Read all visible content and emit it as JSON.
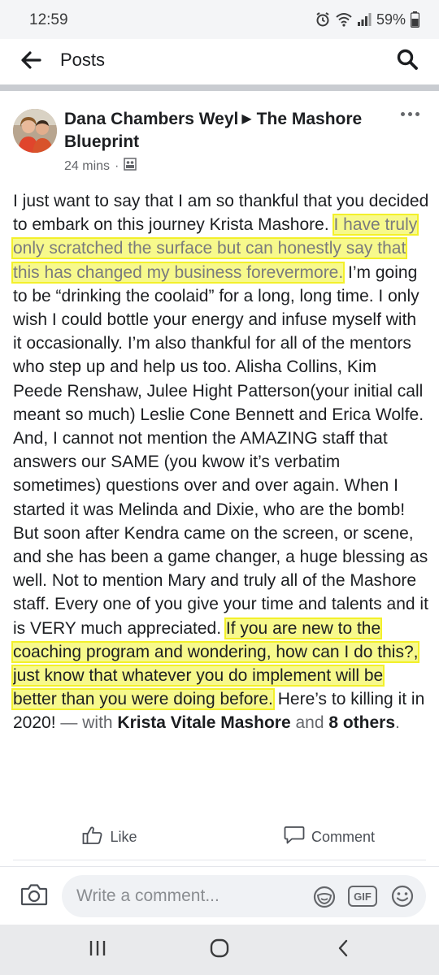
{
  "status_bar": {
    "time": "12:59",
    "battery": "59%",
    "icons": [
      "alarm-icon",
      "wifi-icon",
      "signal-icon",
      "battery-icon"
    ]
  },
  "header": {
    "title": "Posts",
    "back_icon": "arrow-left-icon",
    "search_icon": "search-icon"
  },
  "post": {
    "author": "Dana Chambers Weyl",
    "group": "The Mashore Blueprint",
    "time": "24 mins",
    "privacy_icon": "group-icon",
    "body_segments": [
      {
        "text": "I just want to say that I am so thankful that you decided to embark on this journey Krista Mashore. ",
        "highlight": false
      },
      {
        "text": "I have truly only scratched the surface but can honestly say that this has changed my business forevermore.",
        "highlight": true
      },
      {
        "text": " I’m going to be “drinking the coolaid” for a long, long time.  I only wish I could bottle your energy and infuse myself with it occasionally.   I’m also thankful for all of the mentors who step up and help us too.  Alisha Collins, Kim Peede Renshaw, Julee Hight Patterson(your initial call meant so much) Leslie Cone Bennett and Erica Wolfe.  And, I cannot not mention the AMAZING staff that answers our SAME (you kwow it’s verbatim sometimes) questions over and over again.  When I started it was Melinda and Dixie, who are the bomb! But soon after Kendra came on the screen, or scene, and she has been a game changer, a huge blessing as well. Not to mention Mary and truly all of the Mashore staff. Every one of you give your time and talents and it is VERY much appreciated. ",
        "highlight": false
      },
      {
        "text": "If you are new to the coaching program and wondering, how can I do this?, just know that whatever you do implement will be better than you were doing before.",
        "highlight": true
      },
      {
        "text": " Here’s to killing it in 2020!",
        "highlight": false
      }
    ],
    "with_prefix": " — with ",
    "tagged_person": "Krista Vitale Mashore",
    "and_text": " and ",
    "others": "8 others",
    "end_punct": "."
  },
  "actions": {
    "like_label": "Like",
    "comment_label": "Comment"
  },
  "comment_bar": {
    "placeholder": "Write a comment...",
    "gif_label": "GIF"
  },
  "colors": {
    "highlight": "#f7f98c",
    "highlight_border": "#f3f02a",
    "text": "#1c1e21",
    "muted": "#65676b"
  }
}
